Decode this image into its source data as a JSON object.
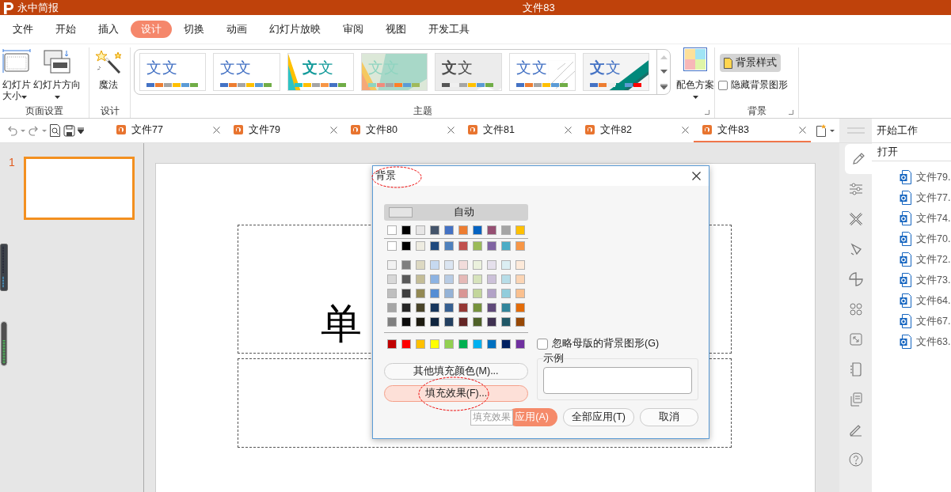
{
  "app": {
    "name": "永中简报",
    "document_title": "文件83"
  },
  "menu": [
    {
      "label": "文件",
      "selected": false
    },
    {
      "label": "开始",
      "selected": false
    },
    {
      "label": "插入",
      "selected": false
    },
    {
      "label": "设计",
      "selected": true
    },
    {
      "label": "切换",
      "selected": false
    },
    {
      "label": "动画",
      "selected": false
    },
    {
      "label": "幻灯片放映",
      "selected": false
    },
    {
      "label": "审阅",
      "selected": false
    },
    {
      "label": "视图",
      "selected": false
    },
    {
      "label": "开发工具",
      "selected": false
    }
  ],
  "ribbon": {
    "page_setup": {
      "label": "页面设置",
      "buttons": [
        {
          "label": "幻灯片大小",
          "kind": "size"
        },
        {
          "label": "幻灯片方向",
          "kind": "orientation"
        }
      ]
    },
    "design": {
      "label": "设计",
      "button": "魔法"
    },
    "themes": {
      "label": "主题",
      "color_scheme": "配色方案",
      "items": [
        {
          "kind": "plain",
          "sample": "文文",
          "colors": [
            {
              "color": "#4472c4"
            },
            {
              "color": "#ed7d31"
            },
            {
              "color": "#a5a5a5"
            },
            {
              "color": "#ffc000"
            },
            {
              "color": "#5b9bd5"
            },
            {
              "color": "#70ad47"
            }
          ]
        },
        {
          "kind": "plain",
          "sample": "文文",
          "colors": [
            {
              "color": "#4472c4"
            },
            {
              "color": "#ed7d31"
            },
            {
              "color": "#a5a5a5"
            },
            {
              "color": "#ffc000"
            },
            {
              "color": "#5b9bd5"
            },
            {
              "color": "#70ad47"
            }
          ]
        },
        {
          "kind": "triangle",
          "sample": "**文**文",
          "colors": [
            {
              "color": "#2ec4c4"
            },
            {
              "color": "#ffc000"
            },
            {
              "color": "#a5a5a5"
            },
            {
              "color": "#f79646"
            },
            {
              "color": "#4472c4"
            },
            {
              "color": "#70ad47"
            }
          ]
        },
        {
          "kind": "mint",
          "sample": "文文",
          "colors": [
            {
              "color": "#8fd4c0"
            },
            {
              "color": "#f08c7c"
            },
            {
              "color": "#a5a5a5"
            },
            {
              "color": "#ff7f27"
            },
            {
              "color": "#5b9bd5"
            },
            {
              "color": "#9fba5a"
            }
          ]
        },
        {
          "kind": "grey",
          "sample": "**文**文",
          "colors": [
            {
              "color": "#555555"
            },
            {
              "color": "#f0f0f0"
            },
            {
              "color": "#a5a5a5"
            },
            {
              "color": "#ffc000"
            },
            {
              "color": "#5b9bd5"
            },
            {
              "color": "#70ad47"
            }
          ]
        },
        {
          "kind": "lines",
          "sample": "文文",
          "colors": [
            {
              "color": "#4472c4"
            },
            {
              "color": "#ed7d31"
            },
            {
              "color": "#a5a5a5"
            },
            {
              "color": "#ffc000"
            },
            {
              "color": "#5b9bd5"
            },
            {
              "color": "#70ad47"
            }
          ]
        },
        {
          "kind": "stripe",
          "sample": "**文**文",
          "colors": [
            {
              "color": "#4472c4"
            },
            {
              "color": "#ed7d31"
            },
            {
              "color": "#eeeeee"
            },
            {
              "color": "#00897b"
            },
            {
              "color": "#5b9bd5"
            },
            {
              "color": "#ff0000"
            }
          ]
        }
      ]
    },
    "background": {
      "label": "背景",
      "style_button": {
        "label": "背景样式",
        "active": true
      },
      "hide_graphics": {
        "label": "隐藏背景图形",
        "checked": false
      }
    }
  },
  "doc_tabs": [
    {
      "label": "文件77",
      "selected": false
    },
    {
      "label": "文件79",
      "selected": false
    },
    {
      "label": "文件80",
      "selected": false
    },
    {
      "label": "文件81",
      "selected": false
    },
    {
      "label": "文件82",
      "selected": false
    },
    {
      "label": "文件83",
      "selected": true
    }
  ],
  "slides": [
    {
      "number": "1",
      "selected": true
    }
  ],
  "slide": {
    "title": "单"
  },
  "task_pane": {
    "title": "开始工作",
    "section": "打开",
    "tools": [
      {
        "selected": true
      },
      {
        "selected": false
      },
      {
        "selected": false
      },
      {
        "selected": false
      },
      {
        "selected": false
      },
      {
        "selected": false
      },
      {
        "selected": false
      },
      {
        "selected": false
      },
      {
        "selected": false
      },
      {
        "selected": false
      },
      {
        "selected": false
      }
    ],
    "files": [
      "文件79.",
      "文件77.",
      "文件74.",
      "文件70.",
      "文件72.",
      "文件73.",
      "文件64.",
      "文件67.",
      "文件63."
    ]
  },
  "dialog": {
    "title": "背景",
    "auto": "自动",
    "palette": [
      {
        "kind": "theme",
        "rows": [
          [
            {
              "color": "#ffffff"
            },
            {
              "color": "#000000"
            },
            {
              "color": "#e7e6e6"
            },
            {
              "color": "#44546a"
            },
            {
              "color": "#4472c4"
            },
            {
              "color": "#ed7d31"
            },
            {
              "color": "#0563c1"
            },
            {
              "color": "#954f72"
            },
            {
              "color": "#a5a5a5"
            },
            {
              "color": "#ffc000"
            }
          ]
        ]
      },
      {
        "kind": "scheme",
        "rows": [
          [
            {
              "color": "#ffffff"
            },
            {
              "color": "#000000"
            },
            {
              "color": "#eeece1"
            },
            {
              "color": "#1f497d"
            },
            {
              "color": "#4f81bd"
            },
            {
              "color": "#c0504d"
            },
            {
              "color": "#9bbb59"
            },
            {
              "color": "#8064a2"
            },
            {
              "color": "#4bacc6"
            },
            {
              "color": "#f79646"
            }
          ]
        ]
      },
      {
        "kind": "shades",
        "rows": [
          [
            {
              "color": "#f2f2f2"
            },
            {
              "color": "#7f7f7f"
            },
            {
              "color": "#ddd9c3"
            },
            {
              "color": "#c6d9f0"
            },
            {
              "color": "#dbe5f1"
            },
            {
              "color": "#f2dcdb"
            },
            {
              "color": "#ebf1dd"
            },
            {
              "color": "#e5e0ec"
            },
            {
              "color": "#dbeef3"
            },
            {
              "color": "#fdeada"
            }
          ],
          [
            {
              "color": "#d8d8d8"
            },
            {
              "color": "#595959"
            },
            {
              "color": "#c4bd97"
            },
            {
              "color": "#8db3e2"
            },
            {
              "color": "#b8cce4"
            },
            {
              "color": "#e5b9b7"
            },
            {
              "color": "#d7e3bc"
            },
            {
              "color": "#ccc1d9"
            },
            {
              "color": "#b7dde8"
            },
            {
              "color": "#fbd5b5"
            }
          ],
          [
            {
              "color": "#bfbfbf"
            },
            {
              "color": "#3f3f3f"
            },
            {
              "color": "#938953"
            },
            {
              "color": "#548dd4"
            },
            {
              "color": "#95b3d7"
            },
            {
              "color": "#d99694"
            },
            {
              "color": "#c3d69b"
            },
            {
              "color": "#b2a2c7"
            },
            {
              "color": "#92cddc"
            },
            {
              "color": "#fac08f"
            }
          ],
          [
            {
              "color": "#a5a5a5"
            },
            {
              "color": "#262626"
            },
            {
              "color": "#494429"
            },
            {
              "color": "#17365d"
            },
            {
              "color": "#366092"
            },
            {
              "color": "#953734"
            },
            {
              "color": "#76923c"
            },
            {
              "color": "#5f497a"
            },
            {
              "color": "#31859b"
            },
            {
              "color": "#e36c09"
            }
          ],
          [
            {
              "color": "#7f7f7f"
            },
            {
              "color": "#0c0c0c"
            },
            {
              "color": "#1d1b10"
            },
            {
              "color": "#0f243e"
            },
            {
              "color": "#244061"
            },
            {
              "color": "#632423"
            },
            {
              "color": "#4f6128"
            },
            {
              "color": "#3f3151"
            },
            {
              "color": "#205867"
            },
            {
              "color": "#974806"
            }
          ]
        ]
      },
      {
        "kind": "standard",
        "rows": [
          [
            {
              "color": "#c00000"
            },
            {
              "color": "#ff0000"
            },
            {
              "color": "#ffc000"
            },
            {
              "color": "#ffff00"
            },
            {
              "color": "#92d050"
            },
            {
              "color": "#00b050"
            },
            {
              "color": "#00b0f0"
            },
            {
              "color": "#0070c0"
            },
            {
              "color": "#002060"
            },
            {
              "color": "#7030a0"
            }
          ]
        ]
      }
    ],
    "side_buttons": [
      {
        "label": "其他填充颜色(M)...",
        "highlighted": false
      },
      {
        "label": "填充效果(F)...",
        "highlighted": true
      }
    ],
    "ignore_master": {
      "label": "忽略母版的背景图形(G)",
      "checked": false
    },
    "sample_label": "示例",
    "tooltip": "填充效果",
    "buttons": [
      {
        "label": "应用(A)",
        "kind": "primary"
      },
      {
        "label": "全部应用(T)",
        "kind": "default"
      },
      {
        "label": "取消",
        "kind": "default"
      }
    ]
  }
}
